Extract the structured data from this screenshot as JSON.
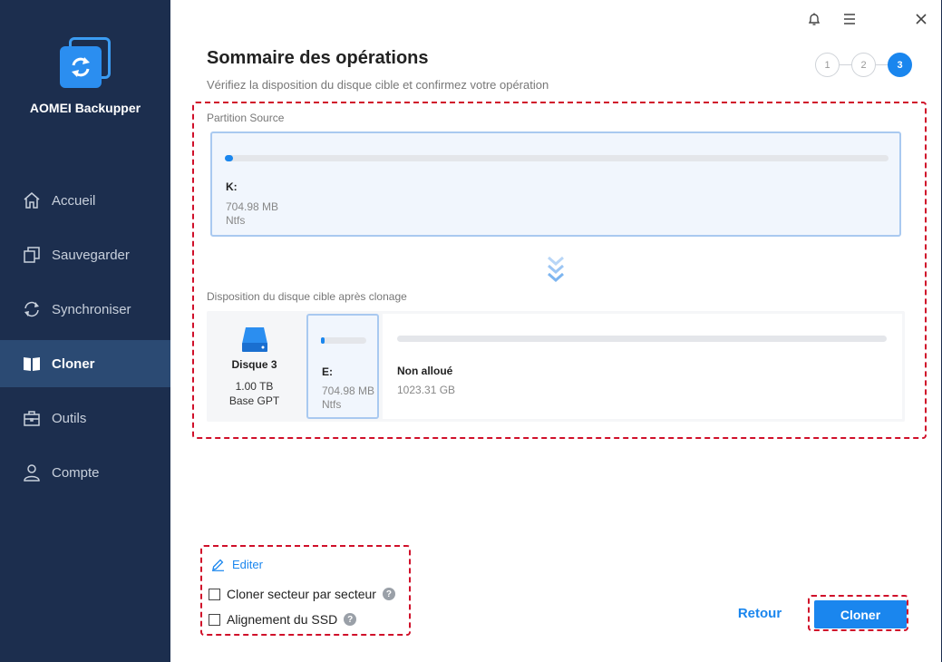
{
  "app": {
    "name": "AOMEI Backupper"
  },
  "sidebar": {
    "items": [
      {
        "label": "Accueil",
        "icon": "home-icon"
      },
      {
        "label": "Sauvegarder",
        "icon": "backup-icon"
      },
      {
        "label": "Synchroniser",
        "icon": "sync-icon"
      },
      {
        "label": "Cloner",
        "icon": "clone-icon",
        "active": true
      },
      {
        "label": "Outils",
        "icon": "tools-icon"
      },
      {
        "label": "Compte",
        "icon": "account-icon"
      }
    ]
  },
  "titlebar": {
    "icons": [
      "bell-icon",
      "menu-icon",
      "close-icon"
    ]
  },
  "header": {
    "title": "Sommaire des opérations",
    "subtitle": "Vérifiez la disposition du disque cible et confirmez votre opération"
  },
  "steps": {
    "labels": [
      "1",
      "2",
      "3"
    ],
    "current": 3
  },
  "source": {
    "label": "Partition Source",
    "partition": {
      "letter": "K:",
      "size": "704.98 MB",
      "fs": "Ntfs",
      "used_fraction": 0.01
    }
  },
  "target": {
    "label": "Disposition du disque cible après clonage",
    "disk": {
      "name": "Disque 3",
      "size": "1.00 TB",
      "type": "Base GPT"
    },
    "partition": {
      "letter": "E:",
      "size": "704.98 MB",
      "fs": "Ntfs",
      "used_fraction": 0.05
    },
    "unallocated": {
      "label": "Non alloué",
      "size": "1023.31 GB"
    }
  },
  "options": {
    "edit_label": "Editer",
    "sector_by_sector": {
      "label": "Cloner secteur par secteur",
      "checked": false
    },
    "ssd_alignment": {
      "label": "Alignement du SSD",
      "checked": false
    },
    "help_glyph": "?"
  },
  "buttons": {
    "back": "Retour",
    "clone": "Cloner"
  },
  "colors": {
    "sidebar_bg": "#1c2e4e",
    "accent": "#1a86ee",
    "highlight_dash": "#d0102a"
  }
}
